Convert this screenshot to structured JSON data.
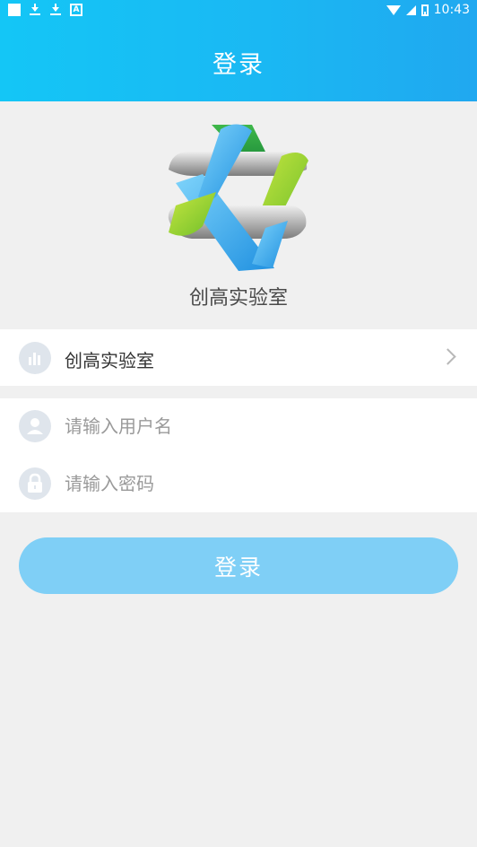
{
  "status_bar": {
    "time": "10:43",
    "notification_a_label": "A"
  },
  "header": {
    "title": "登录"
  },
  "brand": {
    "name": "创高实验室"
  },
  "lab_selector": {
    "value": "创高实验室",
    "icon": "bar-chart-icon"
  },
  "form": {
    "username": {
      "placeholder": "请输入用户名",
      "value": "",
      "icon": "user-icon"
    },
    "password": {
      "placeholder": "请输入密码",
      "value": "",
      "icon": "lock-icon"
    }
  },
  "login_button": {
    "label": "登录",
    "color": "#7fcff6"
  },
  "colors": {
    "header_gradient_start": "#14c6f6",
    "header_gradient_end": "#20a8f0",
    "background": "#f0f0f0",
    "icon_circle": "#dfe5ec"
  }
}
